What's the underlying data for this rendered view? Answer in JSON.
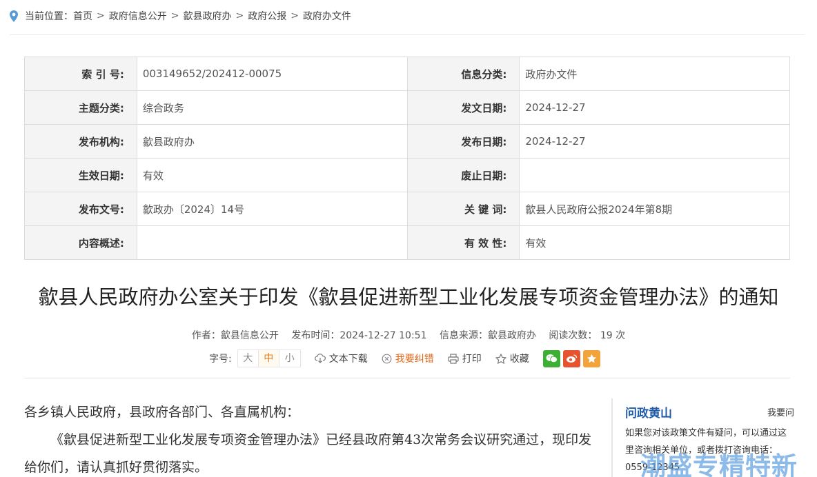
{
  "breadcrumb": {
    "lead": "当前位置：",
    "items": [
      "首页",
      "政府信息公开",
      "歙县政府办",
      "政府公报",
      "政府办文件"
    ]
  },
  "meta_table": [
    {
      "l1": "索 引 号:",
      "v1": "003149652/202412-00075",
      "l2": "信息分类:",
      "v2": "政府办文件"
    },
    {
      "l1": "主题分类:",
      "v1": "综合政务",
      "l2": "发文日期:",
      "v2": "2024-12-27"
    },
    {
      "l1": "发布机构:",
      "v1": "歙县政府办",
      "l2": "发布日期:",
      "v2": "2024-12-27"
    },
    {
      "l1": "生效日期:",
      "v1": "有效",
      "l2": "废止日期:",
      "v2": ""
    },
    {
      "l1": "发布文号:",
      "v1": "歙政办〔2024〕14号",
      "l2": "关 键 词:",
      "v2": "歙县人民政府公报2024年第8期"
    },
    {
      "l1": "内容概述:",
      "v1": "",
      "l2": "有 效 性:",
      "v2": "有效"
    }
  ],
  "article": {
    "title": "歙县人民政府办公室关于印发《歙县促进新型工业化发展专项资金管理办法》的通知",
    "author": "作者：歙县信息公开",
    "publish_time": "发布时间：2024-12-27 10:51",
    "source": "信息来源：歙县政府办",
    "reads": "阅读次数： 19 次",
    "salutation": "各乡镇人民政府，县政府各部门、各直属机构：",
    "paragraph": "《歙县促进新型工业化发展专项资金管理办法》已经县政府第43次常务会议研究通过，现印发给你们，请认真抓好贯彻落实。"
  },
  "tools": {
    "font_label": "字号:",
    "sizes": [
      "大",
      "中",
      "小"
    ],
    "active_size": "中",
    "download": "文本下载",
    "correction": "我要纠错",
    "print": "打印",
    "favorite": "收藏"
  },
  "sidebar": {
    "name": "问政黄山",
    "ask": "我要问",
    "desc": "如果您对该政策文件有疑问，可以通过这里咨询相关单位，或者拨打咨询电话：0559-12345"
  },
  "watermark": "潮盛专精特新",
  "colors": {
    "accent_blue": "#1f5aa6",
    "correction_orange": "#e0681a",
    "wechat_green": "#3cb034",
    "weibo_red": "#e8532f",
    "favorite_orange": "#f2a33a",
    "pin_blue": "#5b9bd5"
  }
}
